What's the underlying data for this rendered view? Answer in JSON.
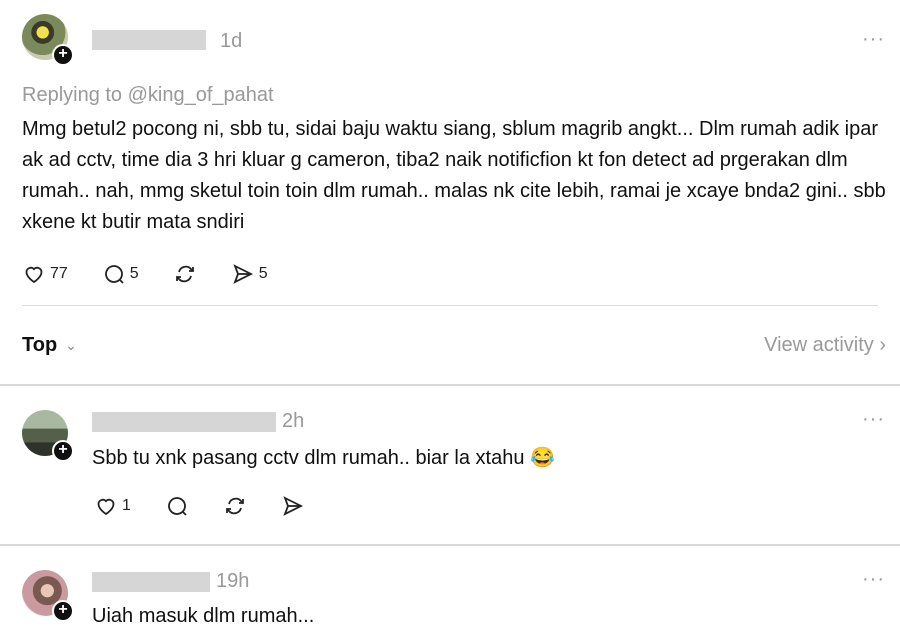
{
  "post": {
    "time": "1d",
    "replying_to": "Replying to @king_of_pahat",
    "text": "Mmg betul2 pocong ni, sbb tu, sidai baju waktu siang, sblum magrib angkt... Dlm rumah adik ipar ak ad cctv, time dia 3 hri kluar g cameron, tiba2 naik notificfion kt fon detect ad prgerakan dlm rumah.. nah, mmg sketul toin toin dlm rumah.. malas nk cite lebih, ramai je xcaye bnda2 gini.. sbb xkene kt butir mata sndiri",
    "likes": "77",
    "replies": "5",
    "shares": "5",
    "more": "···"
  },
  "sort_bar": {
    "label": "Top",
    "chevron": "⌄",
    "view_activity": "View activity ›"
  },
  "comments": [
    {
      "time": "2h",
      "text": "Sbb tu xnk pasang cctv dlm rumah.. biar la xtahu 😂",
      "likes": "1",
      "more": "···"
    },
    {
      "time": "19h",
      "text": "Uiah masuk dlm rumah...",
      "more": "···"
    }
  ],
  "icons": {
    "like": "heart-icon",
    "reply": "comment-icon",
    "repost": "repost-icon",
    "share": "send-icon",
    "add": "plus-icon"
  }
}
